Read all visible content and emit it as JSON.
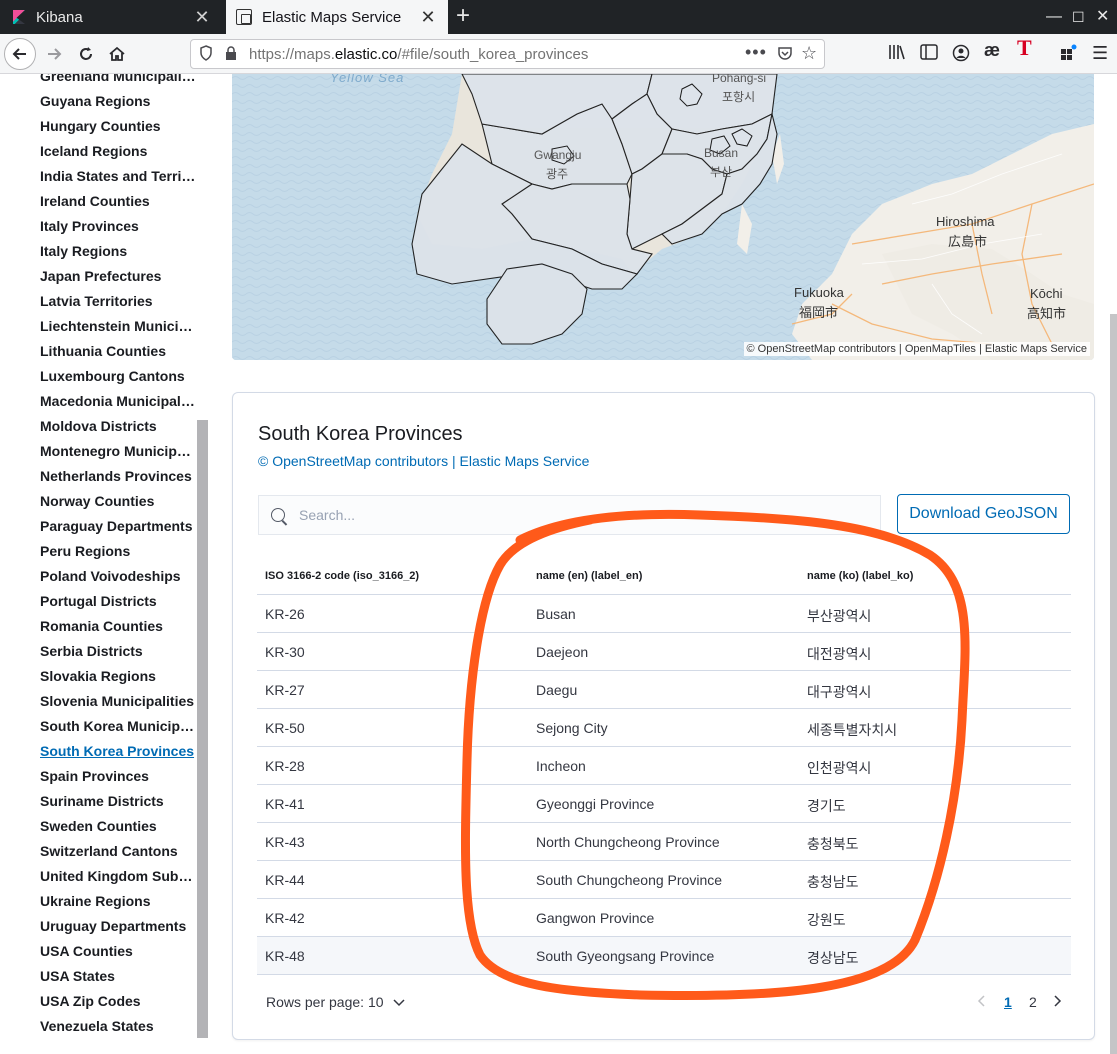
{
  "browser": {
    "tabs": [
      {
        "title": "Kibana"
      },
      {
        "title": "Elastic Maps Service"
      }
    ],
    "url_prefix": "https://maps.",
    "url_domain": "elastic.co",
    "url_path": "/#file/south_korea_provinces"
  },
  "sidebar": {
    "items": [
      {
        "label": "Greenland Municipalities"
      },
      {
        "label": "Guyana Regions"
      },
      {
        "label": "Hungary Counties"
      },
      {
        "label": "Iceland Regions"
      },
      {
        "label": "India States and Territories"
      },
      {
        "label": "Ireland Counties"
      },
      {
        "label": "Italy Provinces"
      },
      {
        "label": "Italy Regions"
      },
      {
        "label": "Japan Prefectures"
      },
      {
        "label": "Latvia Territories"
      },
      {
        "label": "Liechtenstein Municipalities"
      },
      {
        "label": "Lithuania Counties"
      },
      {
        "label": "Luxembourg Cantons"
      },
      {
        "label": "Macedonia Municipalities"
      },
      {
        "label": "Moldova Districts"
      },
      {
        "label": "Montenegro Municipalities"
      },
      {
        "label": "Netherlands Provinces"
      },
      {
        "label": "Norway Counties"
      },
      {
        "label": "Paraguay Departments"
      },
      {
        "label": "Peru Regions"
      },
      {
        "label": "Poland Voivodeships"
      },
      {
        "label": "Portugal Districts"
      },
      {
        "label": "Romania Counties"
      },
      {
        "label": "Serbia Districts"
      },
      {
        "label": "Slovakia Regions"
      },
      {
        "label": "Slovenia Municipalities"
      },
      {
        "label": "South Korea Municipalities"
      },
      {
        "label": "South Korea Provinces",
        "active": true
      },
      {
        "label": "Spain Provinces"
      },
      {
        "label": "Suriname Districts"
      },
      {
        "label": "Sweden Counties"
      },
      {
        "label": "Switzerland Cantons"
      },
      {
        "label": "United Kingdom Subdivisions"
      },
      {
        "label": "Ukraine Regions"
      },
      {
        "label": "Uruguay Departments"
      },
      {
        "label": "USA Counties"
      },
      {
        "label": "USA States"
      },
      {
        "label": "USA Zip Codes"
      },
      {
        "label": "Venezuela States"
      }
    ]
  },
  "map": {
    "labels": {
      "sea": "Yellow Sea",
      "pohang_en": "Pohang-si",
      "pohang_ko": "포항시",
      "gwangju_en": "Gwangju",
      "gwangju_ko": "광주",
      "busan_en": "Busan",
      "busan_ko": "부산",
      "hiroshima_en": "Hiroshima",
      "hiroshima_ja": "広島市",
      "fukuoka_en": "Fukuoka",
      "fukuoka_ja": "福岡市",
      "kochi_en": "Kōchi",
      "kochi_ja": "高知市"
    },
    "attribution": "© OpenStreetMap contributors | OpenMapTiles | Elastic Maps Service",
    "colors": {
      "water": "#c5dbe9",
      "land": "#f2efe9",
      "region_fill": "#dde3ea",
      "region_border": "#1a1a1a",
      "roads": "#f5b370"
    }
  },
  "panel": {
    "title": "South Korea Provinces",
    "attribution_link1": "© OpenStreetMap contributors",
    "attribution_sep": " | ",
    "attribution_link2": "Elastic Maps Service",
    "search_placeholder": "Search...",
    "download_label": "Download GeoJSON",
    "columns": [
      "ISO 3166-2 code (iso_3166_2)",
      "name (en) (label_en)",
      "name (ko) (label_ko)"
    ],
    "rows": [
      [
        "KR-26",
        "Busan",
        "부산광역시"
      ],
      [
        "KR-30",
        "Daejeon",
        "대전광역시"
      ],
      [
        "KR-27",
        "Daegu",
        "대구광역시"
      ],
      [
        "KR-50",
        "Sejong City",
        "세종특별자치시"
      ],
      [
        "KR-28",
        "Incheon",
        "인천광역시"
      ],
      [
        "KR-41",
        "Gyeonggi Province",
        "경기도"
      ],
      [
        "KR-43",
        "North Chungcheong Province",
        "충청북도"
      ],
      [
        "KR-44",
        "South Chungcheong Province",
        "충청남도"
      ],
      [
        "KR-42",
        "Gangwon Province",
        "강원도"
      ],
      [
        "KR-48",
        "South Gyeongsang Province",
        "경상남도"
      ]
    ],
    "rows_per_page_label": "Rows per page: 10",
    "pages": [
      "1",
      "2"
    ],
    "current_page": "1",
    "accent": "#006bb4"
  },
  "annotation": {
    "color": "#ff5a1a",
    "shape": "hand-drawn circle around name columns"
  }
}
